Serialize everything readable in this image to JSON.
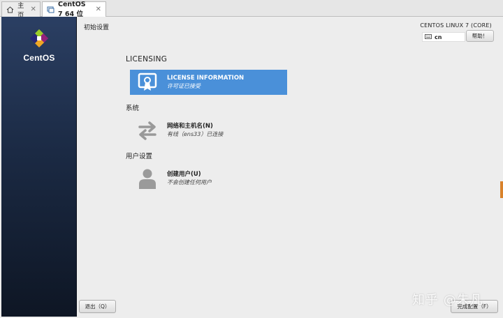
{
  "tabs": [
    {
      "label": "主页",
      "icon": "home-icon",
      "active": false
    },
    {
      "label": "CentOS 7 64 位",
      "icon": "vm-icon",
      "active": true
    }
  ],
  "sidebar": {
    "logo_text": "CentOS"
  },
  "header": {
    "title": "初始设置",
    "product": "CENTOS LINUX 7 (CORE)",
    "keyboard_layout": "cn",
    "help_label": "帮助！"
  },
  "sections": {
    "licensing": {
      "title": "LICENSING",
      "spoke": {
        "name": "LICENSE INFORMATION",
        "status": "许可证已接受"
      }
    },
    "system": {
      "title": "系统",
      "spoke": {
        "name": "网络和主机名(N)",
        "status": "有线（ens33）已连接"
      }
    },
    "user": {
      "title": "用户设置",
      "spoke": {
        "name": "创建用户(U)",
        "status": "不会创建任何用户"
      }
    }
  },
  "footer": {
    "quit_label": "退出（Q）",
    "finish_label": "完成配置（F）",
    "watermark": "知乎 @朱凡"
  },
  "colors": {
    "selected": "#4a90d9",
    "sidebar": "#1b2a44",
    "accent_edge": "#d9822b"
  }
}
